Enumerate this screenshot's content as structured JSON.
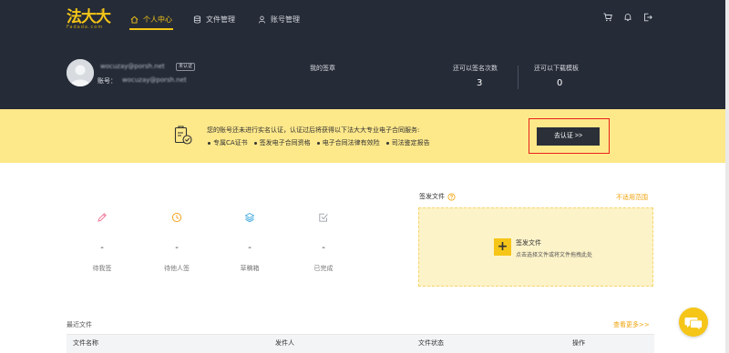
{
  "brand": {
    "name_cn": "法大大",
    "name_en": "Fadada.com",
    "reg_mark": "®"
  },
  "nav": {
    "personal_center": "个人中心",
    "file_management": "文件管理",
    "account_management": "账号管理"
  },
  "user": {
    "email": "wocuzay@porsh.net",
    "auth_badge": "未认证",
    "account_label": "账号：",
    "account_value": "wocuzay@porsh.net"
  },
  "stats": {
    "my_signature": "我的签章",
    "remaining_signs_label": "还可以签名次数",
    "remaining_signs_value": "3",
    "remaining_downloads_label": "还可以下载模板",
    "remaining_downloads_value": "0"
  },
  "banner": {
    "message": "您的账号还未进行实名认证，认证过后将获得以下法大大专业电子合同服务:",
    "benefits": [
      "专属CA证书",
      "签发电子合同资格",
      "电子合同法律有效险",
      "司法鉴定报告"
    ],
    "verify_button": "去认证 >>"
  },
  "counters": [
    {
      "value": "-",
      "label": "待我签"
    },
    {
      "value": "-",
      "label": "待他人签"
    },
    {
      "value": "-",
      "label": "草稿箱"
    },
    {
      "value": "-",
      "label": "已完成"
    }
  ],
  "sign_panel": {
    "title": "签发文件",
    "scope_link": "不适用范围",
    "drop_title": "签发文件",
    "drop_hint": "点击选择文件或将文件拖拽此处",
    "plus": "+"
  },
  "recent": {
    "title": "最近文件",
    "see_more": "查看更多>>",
    "columns": [
      "文件名称",
      "发件人",
      "文件状态",
      "操作"
    ]
  },
  "colors": {
    "header_bg": "#252b37",
    "accent": "#f5c518",
    "banner_bg": "#fde88a",
    "link": "#f0a30a",
    "highlight": "#e8221b"
  }
}
